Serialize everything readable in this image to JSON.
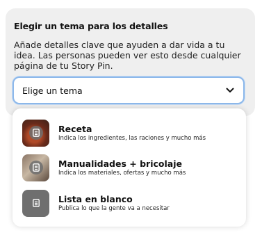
{
  "panel": {
    "heading": "Elegir un tema para los detalles",
    "description": "Añade detalles clave que ayuden a dar vida a tu idea. Las personas pueden ver esto desde cualquier página de tu Story Pin."
  },
  "select": {
    "value": "Elige un tema",
    "icon": "chevron-down-icon"
  },
  "options": [
    {
      "title": "Receta",
      "subtitle": "Indica los ingredientes, las raciones y mucho más",
      "icon": "document-icon"
    },
    {
      "title": "Manualidades + bricolaje",
      "subtitle": "Indica los materiales, ofertas y mucho más",
      "icon": "document-icon"
    },
    {
      "title": "Lista en blanco",
      "subtitle": "Publica lo que la gente va a necesitar",
      "icon": "document-icon"
    }
  ],
  "colors": {
    "panel_bg": "#efefef",
    "focus_ring": "#8db8ea",
    "blank_thumb": "#6f6f6f"
  }
}
